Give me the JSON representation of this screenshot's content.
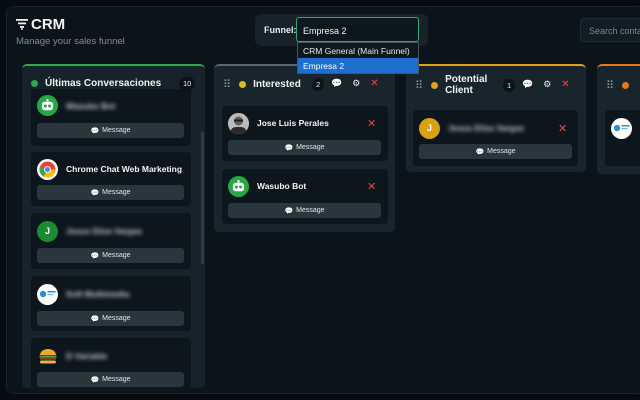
{
  "header": {
    "app_title": "CRM",
    "subtitle": "Manage your sales funnel",
    "funnel_label": "Funnel:",
    "funnel_value": "Empresa 2",
    "funnel_options": [
      "CRM General (Main Funnel)",
      "Empresa 2"
    ],
    "search_placeholder": "Search contacts"
  },
  "columns": [
    {
      "title": "Últimas Conversaciones",
      "count": "10",
      "color": "#2ea84f",
      "cards": [
        {
          "name": "Wasubo Bot",
          "avatar": "bot-avatar",
          "button": "Message"
        },
        {
          "name": "Chrome Chat Web Marketing",
          "avatar": "chrome-avatar",
          "button": "Message"
        },
        {
          "name": "Jesus Eliza Vargas",
          "avatar": "initial-avatar",
          "initial": "J",
          "button": "Message"
        },
        {
          "name": "Soft Multimedia",
          "avatar": "logo-avatar",
          "button": "Message"
        },
        {
          "name": "D Variable",
          "avatar": "burger-avatar",
          "button": "Message"
        }
      ]
    },
    {
      "title": "Interested",
      "count": "2",
      "color": "#d8c21a",
      "cards": [
        {
          "name": "Jose Luis Perales",
          "avatar": "photo-avatar",
          "button": "Message"
        },
        {
          "name": "Wasubo Bot",
          "avatar": "bot-avatar",
          "button": "Message"
        }
      ]
    },
    {
      "title": "Potential Client",
      "count": "1",
      "color": "#e0a11b",
      "cards": [
        {
          "name": "Jesus Eliza Vargas",
          "avatar": "initial-avatar",
          "initial": "J",
          "button": "Message"
        }
      ]
    },
    {
      "title": "",
      "count": "",
      "color": "#e07a1b",
      "cards": [
        {
          "name": "",
          "avatar": "logo-avatar",
          "button": ""
        }
      ]
    }
  ],
  "icons": {
    "chat": "chat-icon",
    "gear": "gear-icon",
    "close": "close-icon",
    "drag": "drag-handle-icon"
  }
}
